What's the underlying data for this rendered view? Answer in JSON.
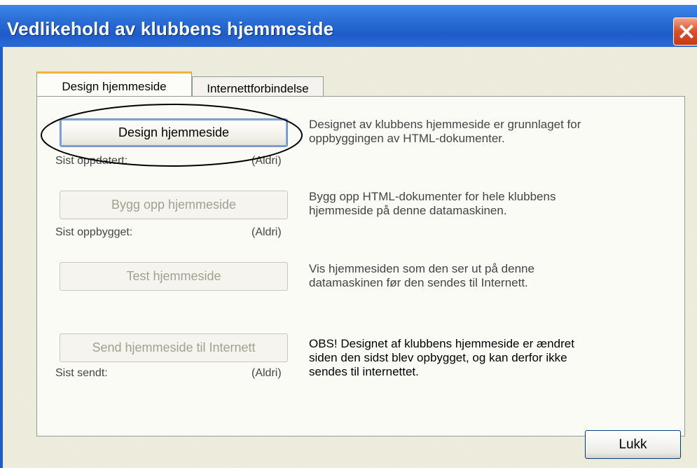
{
  "window": {
    "title": "Vedlikehold av klubbens hjemmeside"
  },
  "tabs": [
    {
      "label": "Design hjemmeside",
      "active": true
    },
    {
      "label": "Internettforbindelse",
      "active": false
    }
  ],
  "actions": [
    {
      "button": "Design hjemmeside",
      "enabled": true,
      "status_label": "Sist oppdatert:",
      "status_value": "(Aldri)",
      "description": [
        "Designet av klubbens hjemmeside er grunnlaget for",
        "oppbyggingen av HTML-dokumenter."
      ]
    },
    {
      "button": "Bygg opp hjemmeside",
      "enabled": false,
      "status_label": "Sist oppbygget:",
      "status_value": "(Aldri)",
      "description": [
        "Bygg opp HTML-dokumenter for hele klubbens",
        "hjemmeside på denne datamaskinen."
      ]
    },
    {
      "button": "Test hjemmeside",
      "enabled": false,
      "description": [
        "Vis hjemmesiden som den ser ut på denne",
        "datamaskinen før den sendes til Internett."
      ]
    },
    {
      "button": "Send hjemmeside til Internett",
      "enabled": false,
      "status_label": "Sist sendt:",
      "status_value": "(Aldri)",
      "description": [
        "OBS!  Designet af klubbens hjemmeside er ændret",
        "siden den sidst blev opbygget, og kan derfor ikke",
        "sendes til internettet."
      ]
    }
  ],
  "footer": {
    "close_label": "Lukk"
  },
  "colors": {
    "titlebar": "#2a6fd6",
    "tab_highlight": "#f2b33d",
    "annotation": "#000000"
  }
}
